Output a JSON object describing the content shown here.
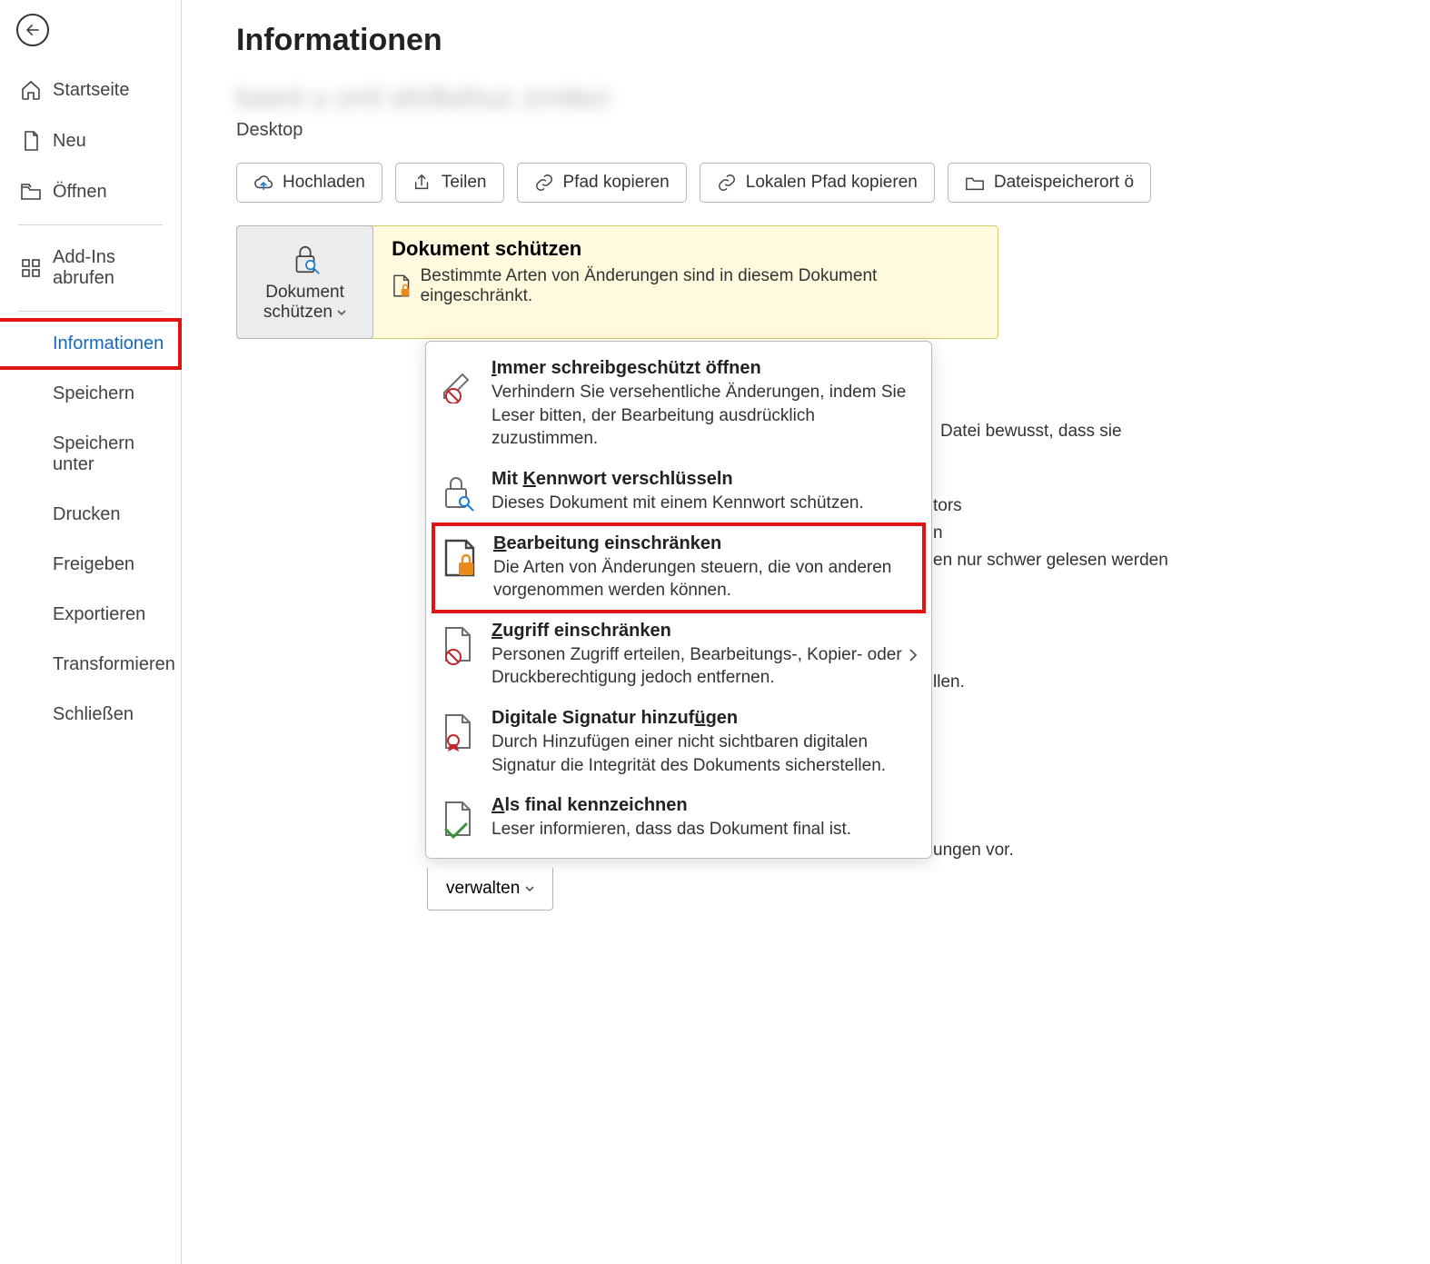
{
  "page_title": "Informationen",
  "doc_title_obscured": "lownt u zml shrlbshuz zrmbcr",
  "doc_path": "Desktop",
  "sidebar": {
    "back": "Zurück",
    "items": [
      {
        "label": "Startseite"
      },
      {
        "label": "Neu"
      },
      {
        "label": "Öffnen"
      }
    ],
    "items2": [
      {
        "label": "Add-Ins abrufen"
      }
    ],
    "items3": [
      {
        "label": "Informationen"
      },
      {
        "label": "Speichern"
      },
      {
        "label": "Speichern unter"
      },
      {
        "label": "Drucken"
      },
      {
        "label": "Freigeben"
      },
      {
        "label": "Exportieren"
      },
      {
        "label": "Transformieren"
      },
      {
        "label": "Schließen"
      }
    ]
  },
  "buttons": {
    "upload": "Hochladen",
    "share": "Teilen",
    "copy_path": "Pfad kopieren",
    "copy_local": "Lokalen Pfad kopieren",
    "open_location": "Dateispeicherort ö"
  },
  "protect": {
    "button_l1": "Dokument",
    "button_l2": "schützen",
    "heading": "Dokument schützen",
    "message": "Bestimmte Arten von Änderungen sind in diesem Dokument eingeschränkt."
  },
  "dropdown": [
    {
      "title_pre": "",
      "key": "I",
      "title_post": "mmer schreibgeschützt öffnen",
      "desc": "Verhindern Sie versehentliche Änderungen, indem Sie Leser bitten, der Bearbeitung ausdrücklich zuzustimmen."
    },
    {
      "title_pre": "Mit ",
      "key": "K",
      "title_post": "ennwort verschlüsseln",
      "desc": "Dieses Dokument mit einem Kennwort schützen."
    },
    {
      "title_pre": "",
      "key": "B",
      "title_post": "earbeitung einschränken",
      "desc": "Die Arten von Änderungen steuern, die von anderen vorgenommen werden können."
    },
    {
      "title_pre": "",
      "key": "Z",
      "title_post": "ugriff einschränken",
      "desc": "Personen Zugriff erteilen, Bearbeitungs-, Kopier- oder Druckberechtigung jedoch entfernen."
    },
    {
      "title_pre": "Digitale Signatur hinzuf",
      "key": "ü",
      "title_post": "gen",
      "desc": "Durch Hinzufügen einer nicht sichtbaren digitalen Signatur die Integrität des Dokuments sicherstellen."
    },
    {
      "title_pre": "",
      "key": "A",
      "title_post": "ls final kennzeichnen",
      "desc": "Leser informieren, dass das Dokument final ist."
    }
  ],
  "bg": {
    "t1": "Datei bewusst, dass sie",
    "t2": "tors",
    "t3": "n",
    "t4": "en nur schwer gelesen werden",
    "t5": "llen.",
    "t6": "ungen vor."
  },
  "manage_label": "verwalten"
}
